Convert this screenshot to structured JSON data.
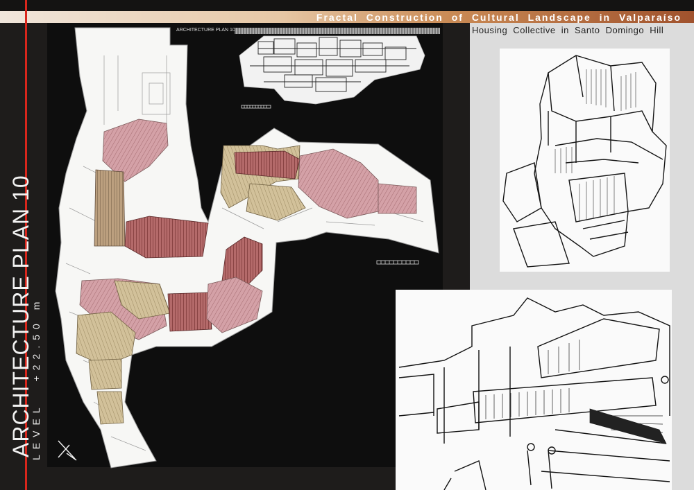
{
  "sheet": {
    "title": "Fractal Construction of Cultural Landscape in Valparaíso",
    "subtitle": "Housing Collective in Santo Domingo Hill"
  },
  "plan": {
    "heading": "ARCHITECTURE PLAN 10",
    "level_label": "LEVEL",
    "level_value": "+22.50 m"
  },
  "section": {
    "label": "ARCHITECTURE PLAN 10"
  },
  "colors": {
    "accent_red": "#d8261c",
    "roof_pink": "#c98f96",
    "roof_tan": "#c9b489",
    "roof_dark": "#8a3e3c"
  },
  "icons": [
    "north-arrow-icon",
    "scale-bar-icon"
  ]
}
